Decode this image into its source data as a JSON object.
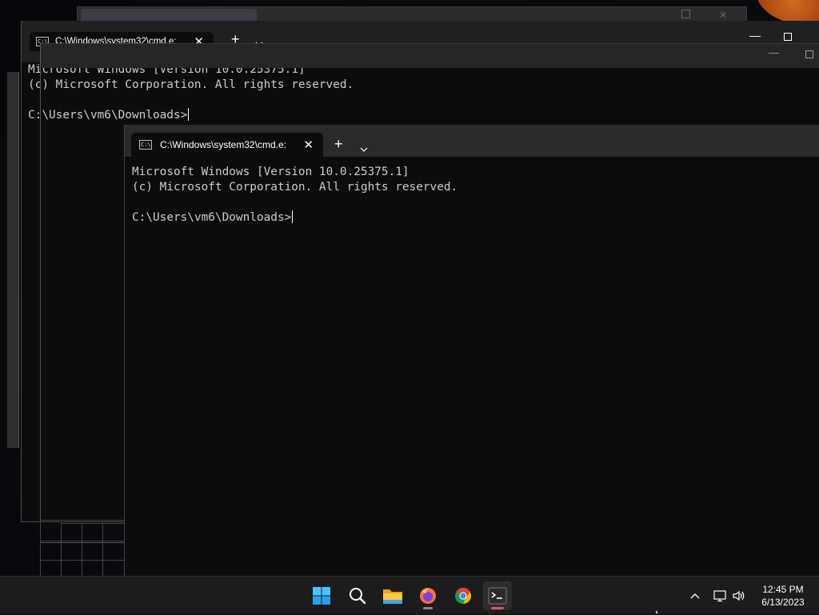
{
  "windows": {
    "back": {
      "tab_title": "C:\\Windows\\system32\\cmd.e:",
      "minimize_glyph": "—",
      "terminal_lines": [
        "Microsoft Windows [Version 10.0.25375.1]",
        "(c) Microsoft Corporation. All rights reserved.",
        "",
        "C:\\Users\\vm6\\Downloads>"
      ]
    },
    "middle": {
      "minimize_glyph": "—"
    },
    "front": {
      "tab_title": "C:\\Windows\\system32\\cmd.e:",
      "terminal_lines": [
        "Microsoft Windows [Version 10.0.25375.1]",
        "(c) Microsoft Corporation. All rights reserved.",
        "",
        "C:\\Users\\vm6\\Downloads>"
      ]
    }
  },
  "tab_close_glyph": "✕",
  "new_tab_glyph": "+",
  "taskbar": {
    "apps": [
      {
        "name": "start-button",
        "icon": "windows-logo-icon"
      },
      {
        "name": "search-button",
        "icon": "search-icon"
      },
      {
        "name": "file-explorer-button",
        "icon": "folder-icon"
      },
      {
        "name": "firefox-button",
        "icon": "firefox-icon"
      },
      {
        "name": "chrome-button",
        "icon": "chrome-icon"
      },
      {
        "name": "terminal-button",
        "icon": "terminal-icon"
      }
    ],
    "clock": {
      "time": "12:45 PM",
      "date": "6/13/2023"
    }
  },
  "colors": {
    "terminal_bg": "#0c0c0c",
    "terminal_text": "#cccccc",
    "titlebar": "#202020",
    "taskbar": "#1c1c1c",
    "active_indicator": "#e84f5f"
  }
}
